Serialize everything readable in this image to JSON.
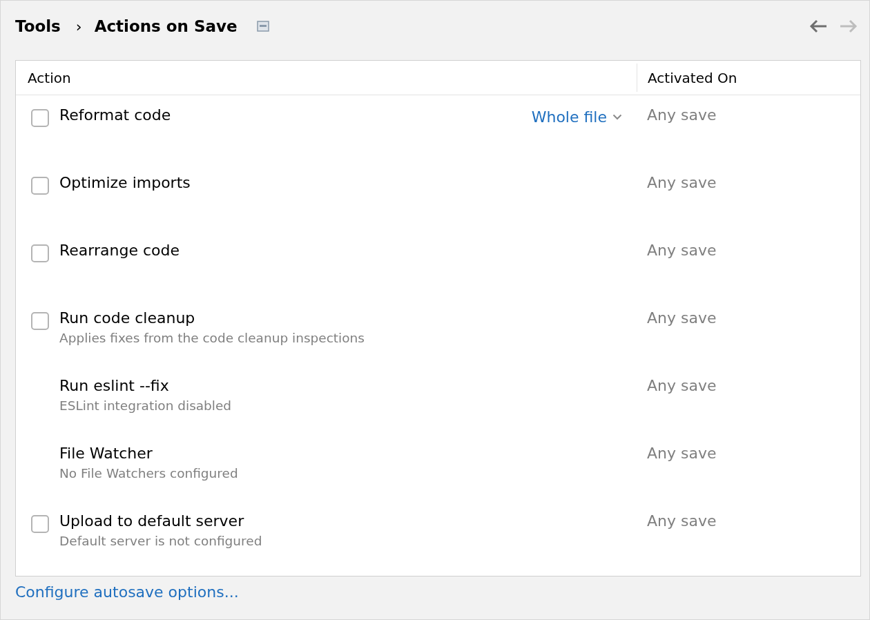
{
  "breadcrumb": {
    "parent": "Tools",
    "separator": "›",
    "current": "Actions on Save"
  },
  "table": {
    "columns": [
      "Action",
      "Activated On"
    ],
    "rows": [
      {
        "kind": "checkbox",
        "checked": false,
        "label": "Reformat code",
        "option": "Whole file",
        "activated_on": "Any save"
      },
      {
        "kind": "checkbox",
        "checked": false,
        "label": "Optimize imports",
        "activated_on": "Any save"
      },
      {
        "kind": "checkbox",
        "checked": false,
        "label": "Rearrange code",
        "activated_on": "Any save"
      },
      {
        "kind": "checkbox",
        "checked": false,
        "label": "Run code cleanup",
        "description": "Applies fixes from the code cleanup inspections",
        "activated_on": "Any save"
      },
      {
        "kind": "plain",
        "label": "Run eslint --fix",
        "description": "ESLint integration disabled",
        "activated_on": "Any save"
      },
      {
        "kind": "plain",
        "label": "File Watcher",
        "description": "No File Watchers configured",
        "activated_on": "Any save"
      },
      {
        "kind": "checkbox",
        "checked": false,
        "label": "Upload to default server",
        "description": "Default server is not configured",
        "activated_on": "Any save"
      }
    ]
  },
  "footer_link": "Configure autosave options..."
}
